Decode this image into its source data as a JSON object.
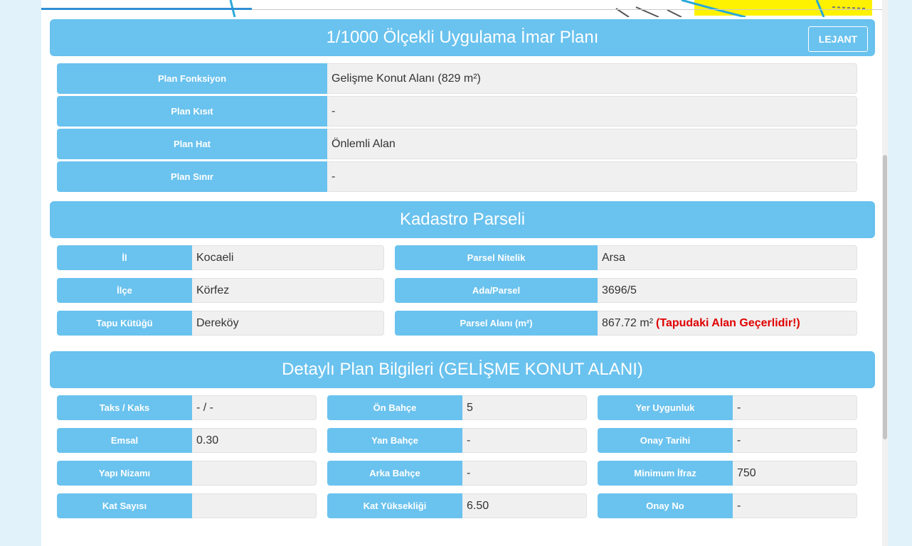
{
  "plan": {
    "title": "1/1000 Ölçekli Uygulama İmar Planı",
    "lejant_label": "LEJANT",
    "rows": [
      {
        "label": "Plan Fonksiyon",
        "value": "Gelişme Konut Alanı (829 m²)"
      },
      {
        "label": "Plan Kısıt",
        "value": "-"
      },
      {
        "label": "Plan Hat",
        "value": "Önlemli Alan"
      },
      {
        "label": "Plan Sınır",
        "value": "-"
      }
    ]
  },
  "kadastro": {
    "title": "Kadastro Parseli",
    "left": [
      {
        "label": "İl",
        "value": "Kocaeli"
      },
      {
        "label": "İlçe",
        "value": "Körfez"
      },
      {
        "label": "Tapu Kütüğü",
        "value": "Dereköy"
      }
    ],
    "right": [
      {
        "label": "Parsel Nitelik",
        "value": "Arsa"
      },
      {
        "label": "Ada/Parsel",
        "value": "3696/5"
      },
      {
        "label": "Parsel Alanı (m²)",
        "value": "867.72 m²",
        "note": "(Tapudaki Alan Geçerlidir!)"
      }
    ]
  },
  "detayli": {
    "title": "Detaylı Plan Bilgileri (GELİŞME KONUT ALANI)",
    "col1": [
      {
        "label": "Taks / Kaks",
        "value": "- / -"
      },
      {
        "label": "Emsal",
        "value": "0.30"
      },
      {
        "label": "Yapı Nizamı",
        "value": ""
      },
      {
        "label": "Kat Sayısı",
        "value": ""
      }
    ],
    "col2": [
      {
        "label": "Ön Bahçe",
        "value": "5"
      },
      {
        "label": "Yan Bahçe",
        "value": "-"
      },
      {
        "label": "Arka Bahçe",
        "value": "-"
      },
      {
        "label": "Kat Yüksekliği",
        "value": "6.50"
      }
    ],
    "col3": [
      {
        "label": "Yer Uygunluk",
        "value": "-"
      },
      {
        "label": "Onay Tarihi",
        "value": "-"
      },
      {
        "label": "Minimum İfraz",
        "value": "750"
      },
      {
        "label": "Onay No",
        "value": "-"
      }
    ]
  },
  "colors": {
    "accent": "#6ac2ee",
    "value_bg": "#f0f0f0",
    "warning": "#e00000",
    "tab_active": "#2f8fd4"
  }
}
